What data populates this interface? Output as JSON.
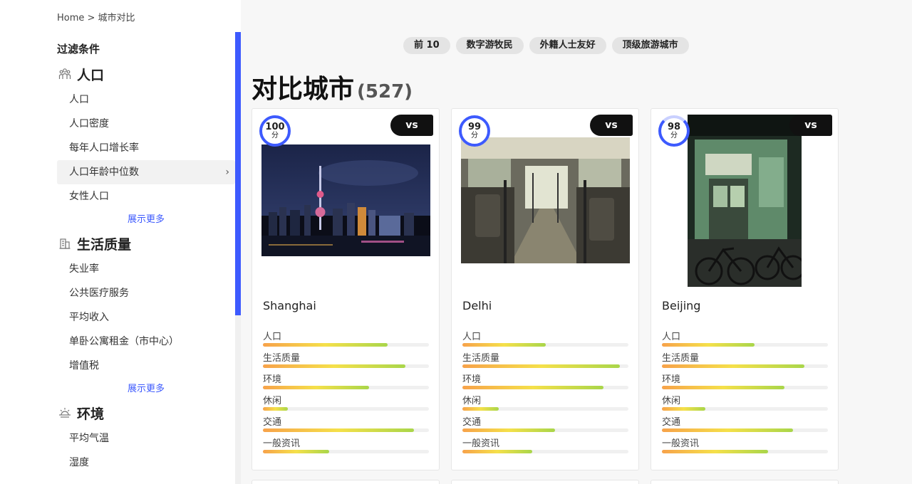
{
  "breadcrumb": "Home > 城市对比",
  "sidebar": {
    "title": "过滤条件",
    "sections": [
      {
        "label": "人口",
        "icon": "people-icon",
        "items": [
          "人口",
          "人口密度",
          "每年人口增长率",
          "人口年龄中位数",
          "女性人口"
        ],
        "active_index": 3,
        "show_more": "展示更多"
      },
      {
        "label": "生活质量",
        "icon": "building-icon",
        "items": [
          "失业率",
          "公共医疗服务",
          "平均收入",
          "单卧公寓租金（市中心）",
          "增值税"
        ],
        "show_more": "展示更多"
      },
      {
        "label": "环境",
        "icon": "sun-icon",
        "items": [
          "平均气温",
          "湿度"
        ]
      }
    ]
  },
  "tags": [
    "前 10",
    "数字游牧民",
    "外籍人士友好",
    "顶级旅游城市"
  ],
  "page_title": "对比城市",
  "page_count": "(527)",
  "vs_label": "vs",
  "score_unit": "分",
  "metric_labels": [
    "人口",
    "生活质量",
    "环境",
    "休闲",
    "交通",
    "一般资讯"
  ],
  "cities": [
    {
      "name": "Shanghai",
      "score": "100",
      "score_pct": 100,
      "metrics": [
        75,
        86,
        64,
        15,
        91,
        40
      ]
    },
    {
      "name": "Delhi",
      "score": "99",
      "score_pct": 99,
      "metrics": [
        50,
        95,
        85,
        22,
        56,
        42
      ]
    },
    {
      "name": "Beijing",
      "score": "98",
      "score_pct": 98,
      "metrics": [
        56,
        86,
        74,
        26,
        79,
        64
      ]
    }
  ],
  "colors": {
    "accent": "#3d5afe",
    "vs_bg": "#111111"
  }
}
